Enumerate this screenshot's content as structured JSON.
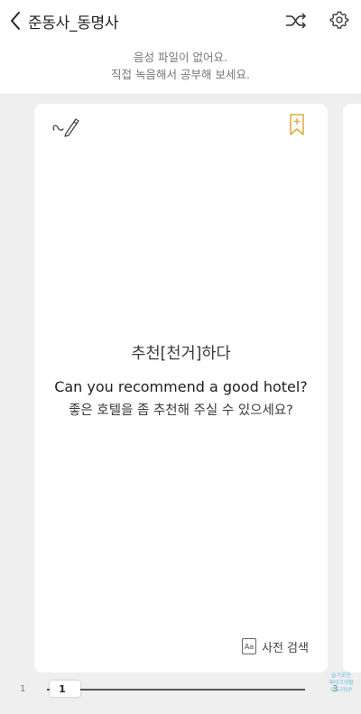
{
  "header": {
    "title": "준동사_동명사",
    "back_icon": "chevron-left-icon",
    "shuffle_icon": "shuffle-icon",
    "settings_icon": "gear-icon"
  },
  "notice": {
    "line1": "음성 파일이 없어요.",
    "line2": "직접 녹음해서 공부해 보세요."
  },
  "card": {
    "pen_icon": "pen-icon",
    "bookmark_icon": "bookmark-add-icon",
    "bookmark_color": "#e0a93a",
    "word": "추천[천거]하다",
    "sentence_en": "Can you recommend a good hotel?",
    "sentence_ko": "좋은 호텔을 좀 추천해 주실 수 있으세요?",
    "dictionary": {
      "icon_text": "Aa",
      "label": "사전 검색"
    }
  },
  "pager": {
    "start": "1",
    "current": "1",
    "end": "3"
  },
  "watermark": {
    "line1": "슬기로운",
    "line2": "재테크생활",
    "line3": "요도리SP"
  }
}
